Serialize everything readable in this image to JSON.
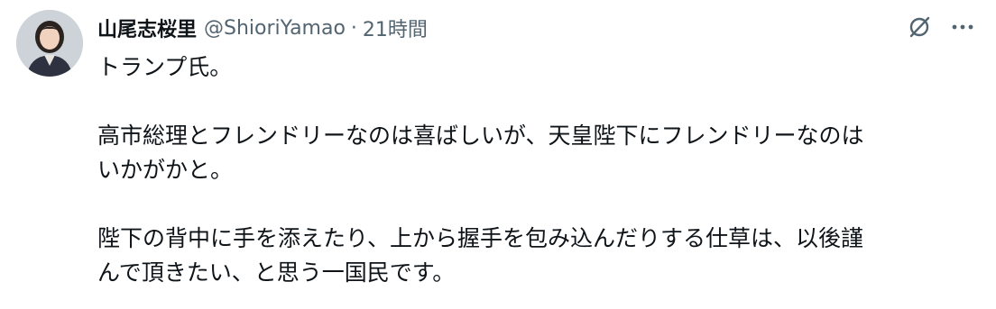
{
  "author": {
    "display_name": "山尾志桜里",
    "handle": "@ShioriYamao",
    "separator": "·",
    "timestamp": "21時間"
  },
  "icons": {
    "grok": "grok-slash-icon",
    "more": "more-options-icon"
  },
  "tweet": {
    "line1": "トランプ氏。",
    "line2": "高市総理とフレンドリーなのは喜ばしいが、天皇陛下にフレンドリーなのは",
    "line3": "いかがかと。",
    "line4": "陛下の背中に手を添えたり、上から握手を包み込んだりする仕草は、以後謹",
    "line5": "んで頂きたい、と思う一国民です。"
  },
  "colors": {
    "text_primary": "#0f1419",
    "text_secondary": "#536471"
  }
}
